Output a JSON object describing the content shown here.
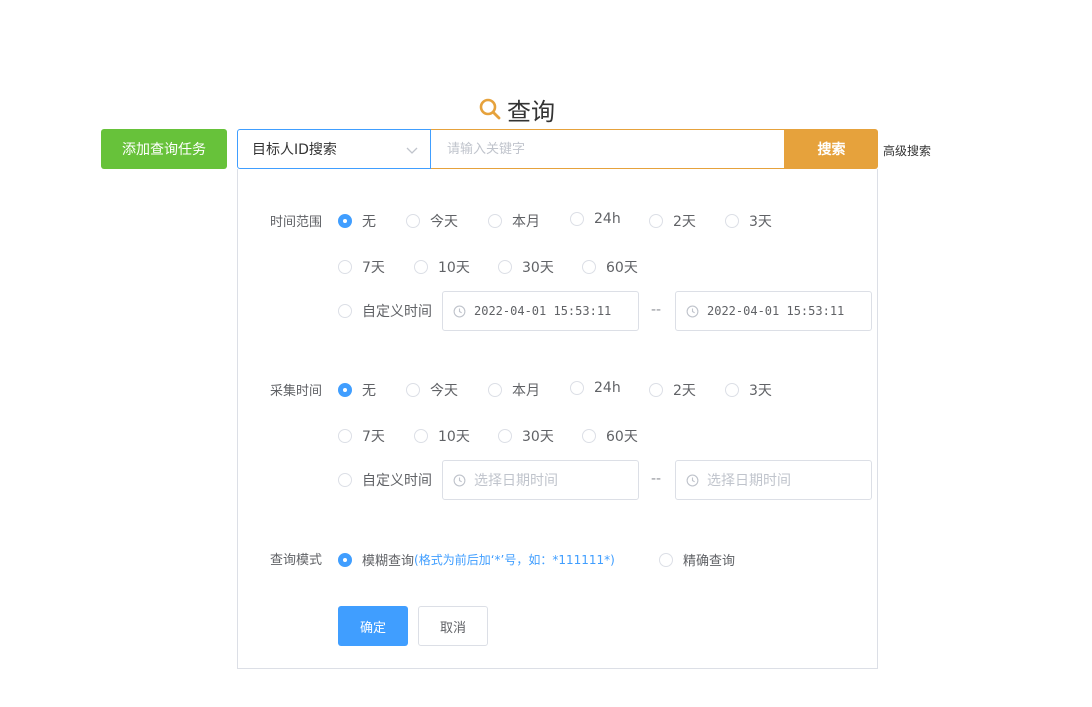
{
  "header": {
    "title": "查询",
    "title_icon": "search-icon"
  },
  "toolbar": {
    "add_task_label": "添加查询任务",
    "search_type_selected": "目标人ID搜索",
    "keyword_placeholder": "请输入关键字",
    "search_label": "搜索",
    "advanced_label": "高级搜索"
  },
  "time_range": {
    "label": "时间范围",
    "options": [
      "无",
      "今天",
      "本月",
      "24h",
      "2天",
      "3天",
      "7天",
      "10天",
      "30天",
      "60天"
    ],
    "selected": "无",
    "custom_label": "自定义时间",
    "start_value": "2022-04-01 15:53:11",
    "end_value": "2022-04-01 15:53:11",
    "separator": "--"
  },
  "collect_time": {
    "label": "采集时间",
    "options": [
      "无",
      "今天",
      "本月",
      "24h",
      "2天",
      "3天",
      "7天",
      "10天",
      "30天",
      "60天"
    ],
    "selected": "无",
    "custom_label": "自定义时间",
    "start_placeholder": "选择日期时间",
    "end_placeholder": "选择日期时间",
    "separator": "--"
  },
  "query_mode": {
    "label": "查询模式",
    "fuzzy_label": "模糊查询",
    "fuzzy_hint": "(格式为前后加‘*’号，如：*111111*)",
    "exact_label": "精确查询",
    "selected": "fuzzy"
  },
  "actions": {
    "confirm_label": "确定",
    "cancel_label": "取消"
  },
  "colors": {
    "add_button": "#67c23a",
    "search_button": "#e6a23c",
    "primary": "#409eff",
    "title_icon": "#e6a23c"
  }
}
